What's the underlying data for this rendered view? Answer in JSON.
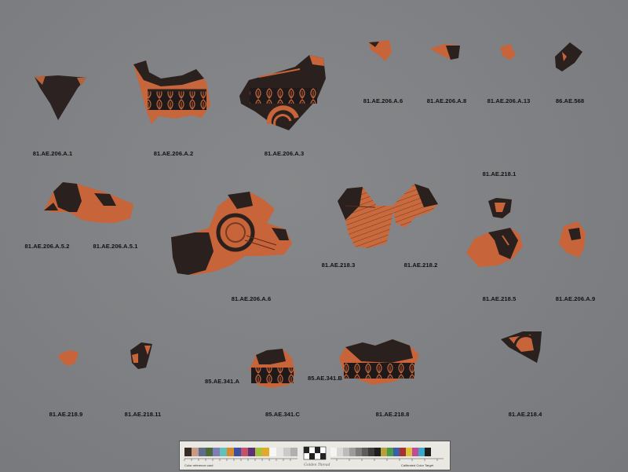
{
  "labels": {
    "l1": "81.AE.206.A.1",
    "l2": "81.AE.206.A.2",
    "l3": "81.AE.206.A.3",
    "l4": "81.AE.206.A.6",
    "l5": "81.AE.206.A.8",
    "l6": "81.AE.206.A.13",
    "l7": "86.AE.568",
    "l8": "81.AE.218.1",
    "l9": "81.AE.206.A.5.2",
    "l10": "81.AE.206.A.5.1",
    "l11": "81.AE.218.3",
    "l12": "81.AE.218.2",
    "l13": "81.AE.206.A.6",
    "l14": "81.AE.218.5",
    "l15": "81.AE.206.A.9",
    "l16": "85.AE.341.A",
    "l17": "85.AE.341.B",
    "l18": "81.AE.218.9",
    "l19": "81.AE.218.11",
    "l20": "85.AE.341.C",
    "l21": "81.AE.218.8",
    "l22": "81.AE.218.4"
  },
  "card": {
    "brand": "Golden Thread",
    "left_note": "Color reference card",
    "right_note": "Calibrated Color Target"
  },
  "colors": {
    "background": "#7e8083",
    "clay": "#c8643a",
    "glaze": "#1e1a1a"
  }
}
